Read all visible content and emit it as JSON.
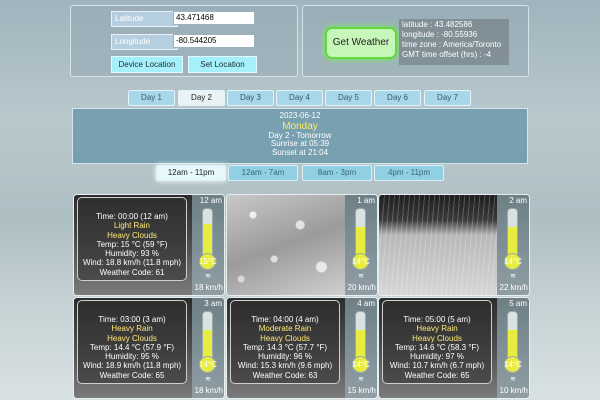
{
  "location": {
    "latitude_label": "Latitude",
    "latitude_value": "43.471468",
    "longitude_label": "Longitude",
    "longitude_value": "-80.544205",
    "device_location_label": "Device Location",
    "set_location_label": "Set Location"
  },
  "result": {
    "get_weather_label": "Get Weather",
    "latitude_line": "latitude : 43.482586",
    "longitude_line": "longitude : -80.55936",
    "timezone_line": "time zone : America/Toronto",
    "gmt_line": "GMT time offset (hrs) : -4"
  },
  "day_tabs": [
    "Day 1",
    "Day 2",
    "Day 3",
    "Day 4",
    "Day 5",
    "Day 6",
    "Day 7"
  ],
  "active_day_index": 1,
  "day_info": {
    "date": "2023-06-12",
    "weekday": "Monday",
    "day_label": "Day 2 - Tomorrow",
    "sunrise": "Sunrise at 05:39",
    "sunset": "Sunset at 21:04"
  },
  "range_tabs": [
    "12am - 11pm",
    "12am - 7am",
    "8am - 3pm",
    "4pm - 11pm"
  ],
  "active_range_index": 0,
  "hours": [
    {
      "hour": "12 am",
      "temp": "15°C",
      "wind": "18 km/h",
      "temp_level": 0.68,
      "show_details": true,
      "scene": "dark",
      "time_line": "Time: 00:00  (12 am)",
      "rain": "Light Rain",
      "clouds": "Heavy Clouds",
      "temp_line": "Temp: 15 °C  (59 °F)",
      "humidity": "Humidity: 93 %",
      "wind_line": "Wind: 18.8 km/h (11.8 mph)",
      "code": "Weather Code: 61"
    },
    {
      "hour": "1 am",
      "temp": "14°C",
      "wind": "20 km/h",
      "temp_level": 0.62,
      "show_details": false,
      "scene": "drops",
      "time_line": "",
      "rain": "",
      "clouds": "",
      "temp_line": "",
      "humidity": "",
      "wind_line": "",
      "code": ""
    },
    {
      "hour": "2 am",
      "temp": "14°C",
      "wind": "22 km/h",
      "temp_level": 0.62,
      "show_details": false,
      "scene": "storm",
      "time_line": "",
      "rain": "",
      "clouds": "",
      "temp_line": "",
      "humidity": "",
      "wind_line": "",
      "code": ""
    },
    {
      "hour": "3 am",
      "temp": "14°C",
      "wind": "18 km/h",
      "temp_level": 0.62,
      "show_details": true,
      "scene": "dark",
      "time_line": "Time: 03:00  (3 am)",
      "rain": "Heavy Rain",
      "clouds": "Heavy Clouds",
      "temp_line": "Temp: 14.4 °C  (57.9 °F)",
      "humidity": "Humidity: 95 %",
      "wind_line": "Wind: 18.9 km/h (11.8 mph)",
      "code": "Weather Code: 65"
    },
    {
      "hour": "4 am",
      "temp": "14°C",
      "wind": "15 km/h",
      "temp_level": 0.62,
      "show_details": true,
      "scene": "dark",
      "time_line": "Time: 04:00  (4 am)",
      "rain": "Moderate Rain",
      "clouds": "Heavy Clouds",
      "temp_line": "Temp: 14.3 °C  (57.7 °F)",
      "humidity": "Humidity: 96 %",
      "wind_line": "Wind: 15.3 km/h (9.6 mph)",
      "code": "Weather Code: 63"
    },
    {
      "hour": "5 am",
      "temp": "14°C",
      "wind": "10 km/h",
      "temp_level": 0.62,
      "show_details": true,
      "scene": "dark",
      "time_line": "Time: 05:00  (5 am)",
      "rain": "Heavy Rain",
      "clouds": "Heavy Clouds",
      "temp_line": "Temp: 14.6 °C  (58.3 °F)",
      "humidity": "Humidity: 97 %",
      "wind_line": "Wind: 10.7 km/h (6.7 mph)",
      "code": "Weather Code: 65"
    }
  ]
}
